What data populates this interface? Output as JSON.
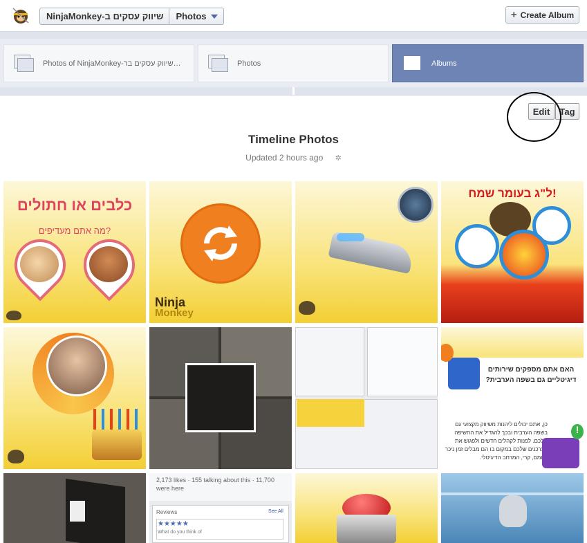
{
  "header": {
    "page_name": "NinjaMonkey-שיווק עסקים ב",
    "section": "Photos",
    "create_album_label": "Create Album"
  },
  "tabs": [
    {
      "label": "Photos of NinjaMonkey-שיווק עסקים בר…"
    },
    {
      "label": "Photos"
    },
    {
      "label": "Albums"
    }
  ],
  "toolbar": {
    "edit_label": "Edit",
    "tag_label": "Tag"
  },
  "album": {
    "title": "Timeline Photos",
    "updated": "Updated 2 hours ago"
  },
  "photos": {
    "p1": {
      "headline": "כלבים או חתולים",
      "sub": "מה אתם מעדיפים?"
    },
    "p2": {
      "brand": "Ninja",
      "brand2": "Monkey"
    },
    "p4": {
      "headline": "ל\"ג בעומר שמח!"
    },
    "p8": {
      "headline": "האם אתם מספקים שירותים דיגיטליים גם בשפה הערבית?",
      "body": "כן, אתם יכולים ליהנות משיווק מקצועי גם בשפה הערבית ובכך להגדיל את החשיפה שלכם. לפנות לקהלים חדשים ולפגוש את הצרכנים שלכם במקום בו הם מבלים זמן ניכר מיומם, קרי, המרחב הדיגיטלי."
    },
    "p10": {
      "likes": "2,173 likes · 155 talking about this · 11,700 were here",
      "reviews": "Reviews",
      "see_all": "See All",
      "stars": "★★★★★",
      "question": "What do you think of"
    }
  },
  "colors": {
    "accent": "#6d84b4",
    "brand_orange": "#f07f1f",
    "yellow": "#f6d23c"
  }
}
